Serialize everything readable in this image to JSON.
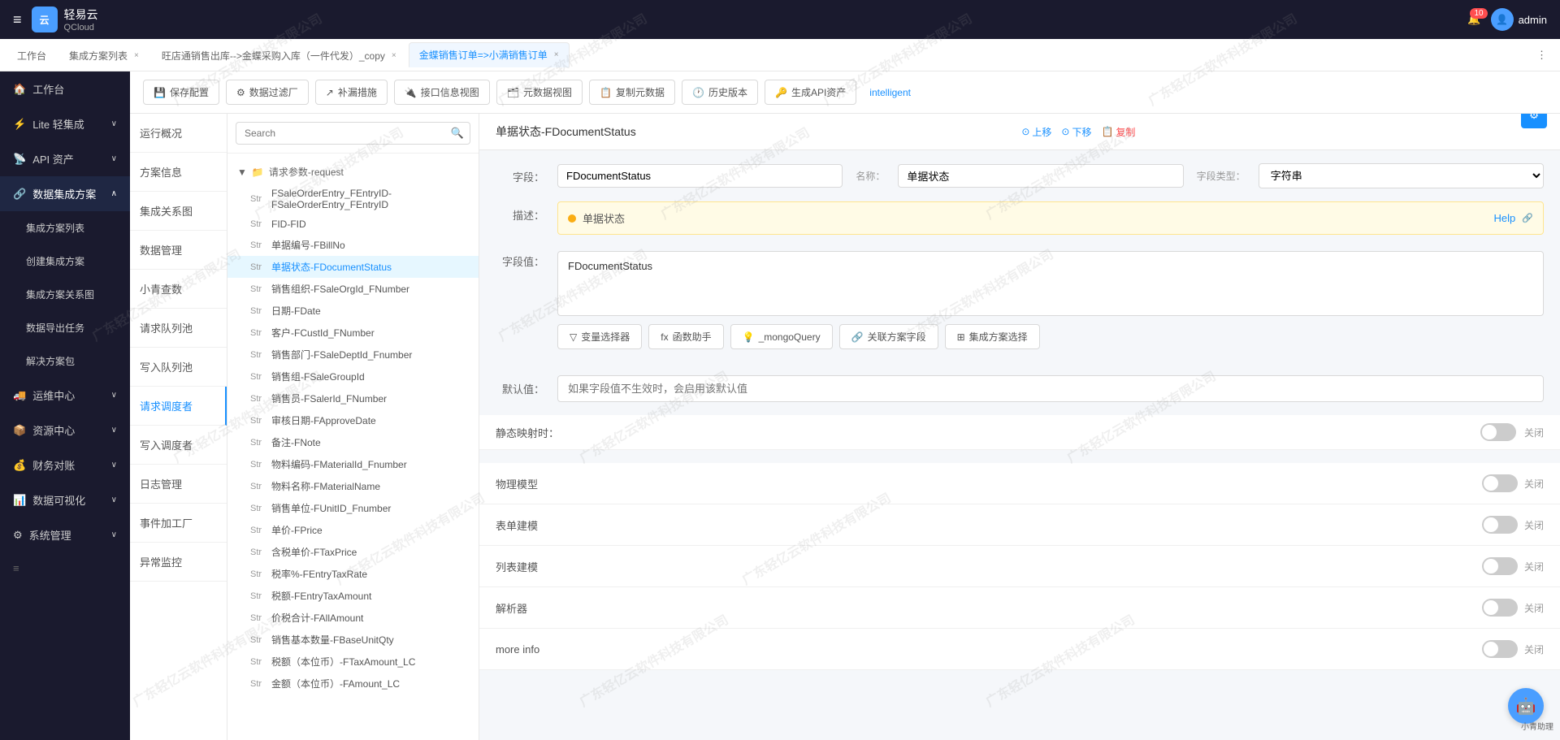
{
  "topbar": {
    "logo_text": "轻易云",
    "logo_sub": "QCloud",
    "menu_icon": "≡",
    "notification_count": "10",
    "username": "admin"
  },
  "tabs": [
    {
      "label": "工作台",
      "closable": false,
      "active": false
    },
    {
      "label": "集成方案列表",
      "closable": true,
      "active": false
    },
    {
      "label": "旺店通销售出库-->金蝶采购入库（一件代发）_copy",
      "closable": true,
      "active": false
    },
    {
      "label": "金蝶销售订单=>小满销售订单",
      "closable": true,
      "active": true
    }
  ],
  "secondary_nav": [
    {
      "label": "运行概况",
      "active": false
    },
    {
      "label": "方案信息",
      "active": false
    },
    {
      "label": "集成关系图",
      "active": false
    },
    {
      "label": "数据管理",
      "active": false
    },
    {
      "label": "小青查数",
      "active": false
    },
    {
      "label": "请求队列池",
      "active": false
    },
    {
      "label": "写入队列池",
      "active": false
    },
    {
      "label": "请求调度者",
      "active": true
    },
    {
      "label": "写入调度者",
      "active": false
    },
    {
      "label": "日志管理",
      "active": false
    },
    {
      "label": "事件加工厂",
      "active": false
    },
    {
      "label": "异常监控",
      "active": false
    }
  ],
  "toolbar": {
    "save_btn": "保存配置",
    "filter_btn": "数据过滤厂",
    "patch_btn": "补漏措施",
    "interface_btn": "接口信息视图",
    "meta_btn": "元数据视图",
    "copy_btn": "复制元数据",
    "history_btn": "历史版本",
    "api_btn": "生成API资产",
    "intelligent_btn": "intelligent"
  },
  "search": {
    "placeholder": "Search"
  },
  "tree": {
    "group_label": "请求参数-request",
    "items": [
      {
        "type": "Str",
        "name": "FSaleOrderEntry_FEntryID-FSaleOrderEntry_FEntryID"
      },
      {
        "type": "Str",
        "name": "FID-FID"
      },
      {
        "type": "Str",
        "name": "单据编号-FBillNo"
      },
      {
        "type": "Str",
        "name": "单据状态-FDocumentStatus",
        "selected": true
      },
      {
        "type": "Str",
        "name": "销售组织-FSaleOrgId_FNumber"
      },
      {
        "type": "Str",
        "name": "日期-FDate"
      },
      {
        "type": "Str",
        "name": "客户-FCustId_FNumber"
      },
      {
        "type": "Str",
        "name": "销售部门-FSaleDeptId_Fnumber"
      },
      {
        "type": "Str",
        "name": "销售组-FSaleGroupId"
      },
      {
        "type": "Str",
        "name": "销售员-FSalerId_FNumber"
      },
      {
        "type": "Str",
        "name": "审核日期-FApproveDate"
      },
      {
        "type": "Str",
        "name": "备注-FNote"
      },
      {
        "type": "Str",
        "name": "物料编码-FMaterialId_Fnumber"
      },
      {
        "type": "Str",
        "name": "物料名称-FMaterialName"
      },
      {
        "type": "Str",
        "name": "销售单位-FUnitID_Fnumber"
      },
      {
        "type": "Str",
        "name": "单价-FPrice"
      },
      {
        "type": "Str",
        "name": "含税单价-FTaxPrice"
      },
      {
        "type": "Str",
        "name": "税率%-FEntryTaxRate"
      },
      {
        "type": "Str",
        "name": "税额-FEntryTaxAmount"
      },
      {
        "type": "Str",
        "name": "价税合计-FAllAmount"
      },
      {
        "type": "Str",
        "name": "销售基本数量-FBaseUnitQty"
      },
      {
        "type": "Str",
        "name": "税额（本位币）-FTaxAmount_LC"
      },
      {
        "type": "Str",
        "name": "金额（本位币）-FAmount_LC"
      }
    ]
  },
  "detail": {
    "title": "单据状态-FDocumentStatus",
    "up_btn": "上移",
    "down_btn": "下移",
    "copy_btn": "复制",
    "field_label": "字段：",
    "field_value": "FDocumentStatus",
    "name_label": "名称：",
    "name_value": "单据状态",
    "type_label": "字段类型：",
    "type_value": "字符串",
    "desc_label": "描述：",
    "desc_value": "单据状态",
    "desc_help": "Help",
    "field_value_label": "字段值：",
    "field_value_content": "FDocumentStatus",
    "var_selector_btn": "变量选择器",
    "func_btn": "函数助手",
    "mongo_btn": "_mongoQuery",
    "relate_btn": "关联方案字段",
    "collect_btn": "集成方案选择",
    "default_label": "默认值：",
    "default_placeholder": "如果字段值不生效时，会启用该默认值",
    "static_map_label": "静态映射时：",
    "static_map_value": "关闭",
    "physical_model_label": "物理模型",
    "physical_model_value": "关闭",
    "form_model_label": "表单建模",
    "form_model_value": "关闭",
    "list_model_label": "列表建模",
    "list_model_value": "关闭",
    "parser_label": "解析器",
    "parser_value": "关闭",
    "more_info_label": "more info",
    "more_info_value": "关闭"
  },
  "sidebar": {
    "items": [
      {
        "icon": "🏠",
        "label": "工作台"
      },
      {
        "icon": "⚡",
        "label": "Lite 轻集成",
        "arrow": "∨"
      },
      {
        "icon": "📡",
        "label": "API 资产",
        "arrow": "∨"
      },
      {
        "icon": "🔗",
        "label": "数据集成方案",
        "arrow": "∧",
        "active": true
      },
      {
        "icon": "🚚",
        "label": "运维中心",
        "arrow": "∨"
      },
      {
        "icon": "📦",
        "label": "资源中心",
        "arrow": "∨"
      },
      {
        "icon": "💰",
        "label": "财务对账",
        "arrow": "∨"
      },
      {
        "icon": "📊",
        "label": "数据可视化",
        "arrow": "∨"
      },
      {
        "icon": "⚙",
        "label": "系统管理",
        "arrow": "∨"
      }
    ],
    "sub_items": [
      {
        "label": "集成方案列表",
        "active": false
      },
      {
        "label": "创建集成方案",
        "active": false
      },
      {
        "label": "集成方案关系图",
        "active": false
      },
      {
        "label": "数据导出任务",
        "active": false
      },
      {
        "label": "解决方案包",
        "active": false
      }
    ]
  },
  "watermark_text": "广东轻亿云软件科技有限公司"
}
